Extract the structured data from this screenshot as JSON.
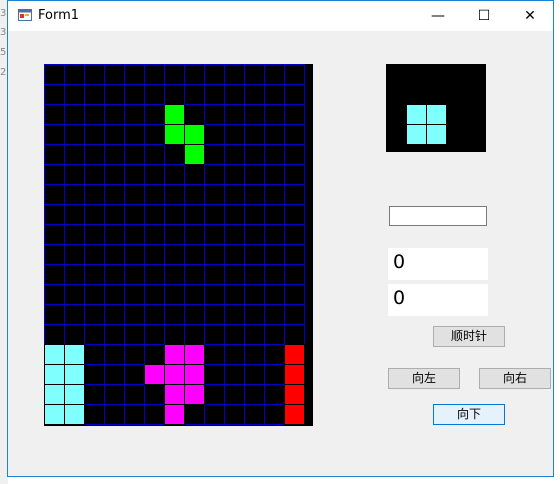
{
  "window": {
    "title": "Form1",
    "minimize": "—",
    "maximize": "☐",
    "close": "✕"
  },
  "background_fragments": [
    "3",
    "3",
    "5",
    "2"
  ],
  "board": {
    "cols": 13,
    "rows": 18,
    "cells": [
      {
        "c": 6,
        "r": 2,
        "color": "#00ff00"
      },
      {
        "c": 6,
        "r": 3,
        "color": "#00ff00"
      },
      {
        "c": 7,
        "r": 3,
        "color": "#00ff00"
      },
      {
        "c": 7,
        "r": 4,
        "color": "#00ff00"
      },
      {
        "c": 0,
        "r": 14,
        "color": "#80ffff"
      },
      {
        "c": 1,
        "r": 14,
        "color": "#80ffff"
      },
      {
        "c": 0,
        "r": 15,
        "color": "#80ffff"
      },
      {
        "c": 1,
        "r": 15,
        "color": "#80ffff"
      },
      {
        "c": 0,
        "r": 16,
        "color": "#80ffff"
      },
      {
        "c": 1,
        "r": 16,
        "color": "#80ffff"
      },
      {
        "c": 0,
        "r": 17,
        "color": "#80ffff"
      },
      {
        "c": 1,
        "r": 17,
        "color": "#80ffff"
      },
      {
        "c": 6,
        "r": 14,
        "color": "#ff00ff"
      },
      {
        "c": 7,
        "r": 14,
        "color": "#ff00ff"
      },
      {
        "c": 5,
        "r": 15,
        "color": "#ff00ff"
      },
      {
        "c": 6,
        "r": 15,
        "color": "#ff00ff"
      },
      {
        "c": 7,
        "r": 15,
        "color": "#ff00ff"
      },
      {
        "c": 6,
        "r": 16,
        "color": "#ff00ff"
      },
      {
        "c": 7,
        "r": 16,
        "color": "#ff00ff"
      },
      {
        "c": 6,
        "r": 17,
        "color": "#ff00ff"
      },
      {
        "c": 12,
        "r": 14,
        "color": "#ff0000"
      },
      {
        "c": 12,
        "r": 15,
        "color": "#ff0000"
      },
      {
        "c": 12,
        "r": 16,
        "color": "#ff0000"
      },
      {
        "c": 12,
        "r": 17,
        "color": "#ff0000"
      }
    ]
  },
  "preview": {
    "cells": [
      {
        "c": 0,
        "r": 0,
        "color": "#80ffff"
      },
      {
        "c": 1,
        "r": 0,
        "color": "#80ffff"
      },
      {
        "c": 0,
        "r": 1,
        "color": "#80ffff"
      },
      {
        "c": 1,
        "r": 1,
        "color": "#80ffff"
      }
    ]
  },
  "inputs": {
    "textbox_value": ""
  },
  "scores": {
    "score1": "0",
    "score2": "0"
  },
  "buttons": {
    "rotate": "顺时针",
    "left": "向左",
    "right": "向右",
    "down": "向下"
  },
  "colors": {
    "grid_line": "#0000c8",
    "board_bg": "#000000",
    "accent": "#0078d7"
  }
}
